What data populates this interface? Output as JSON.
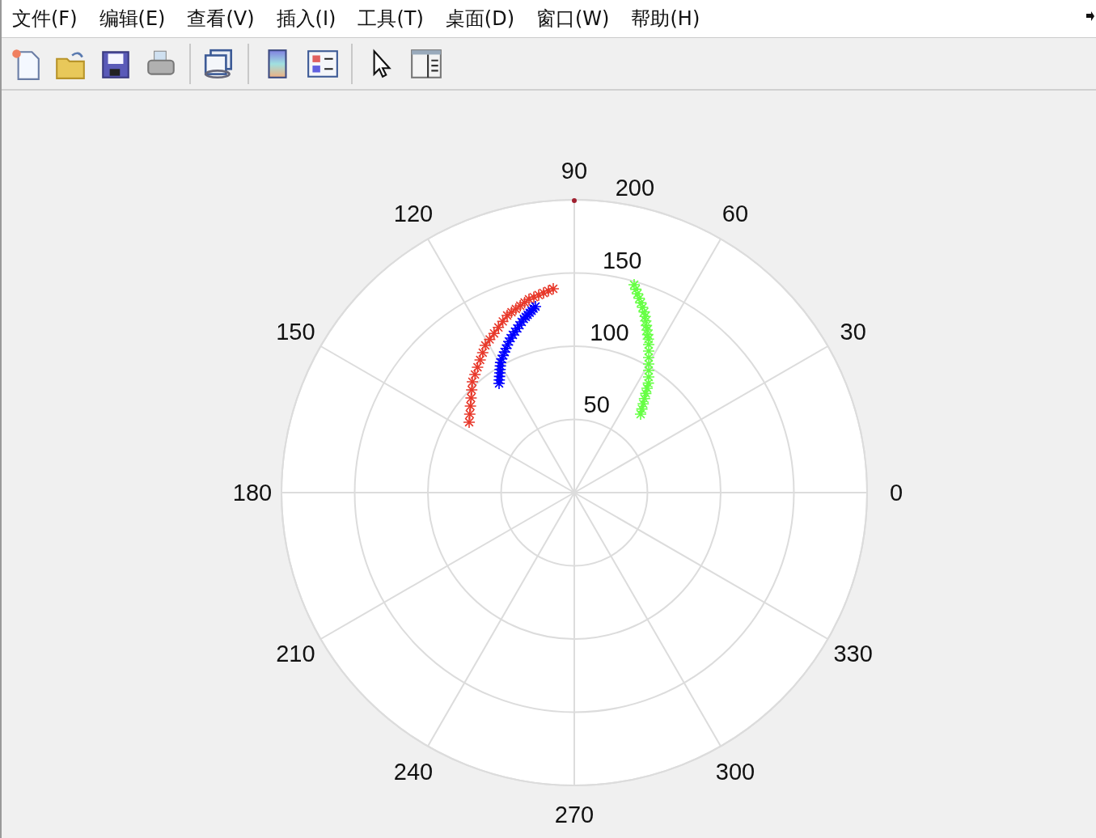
{
  "menu": [
    "文件(F)",
    "编辑(E)",
    "查看(V)",
    "插入(I)",
    "工具(T)",
    "桌面(D)",
    "窗口(W)",
    "帮助(H)"
  ],
  "toolbar": [
    {
      "kind": "new"
    },
    {
      "kind": "open"
    },
    {
      "kind": "save"
    },
    {
      "kind": "print"
    },
    {
      "kind": "sep"
    },
    {
      "kind": "link"
    },
    {
      "kind": "sep"
    },
    {
      "kind": "colorbar"
    },
    {
      "kind": "legend"
    },
    {
      "kind": "sep"
    },
    {
      "kind": "pointer"
    },
    {
      "kind": "panel"
    }
  ],
  "polar_plot": {
    "angle_labels": [
      "0",
      "30",
      "60",
      "90",
      "120",
      "150",
      "180",
      "210",
      "240",
      "270",
      "300",
      "330"
    ],
    "radius_labels": [
      "50",
      "100",
      "150",
      "200"
    ],
    "marker_series": [
      {
        "color": "#e8392b"
      },
      {
        "color": "#0000ff"
      },
      {
        "color": "#66ff44"
      }
    ]
  }
}
